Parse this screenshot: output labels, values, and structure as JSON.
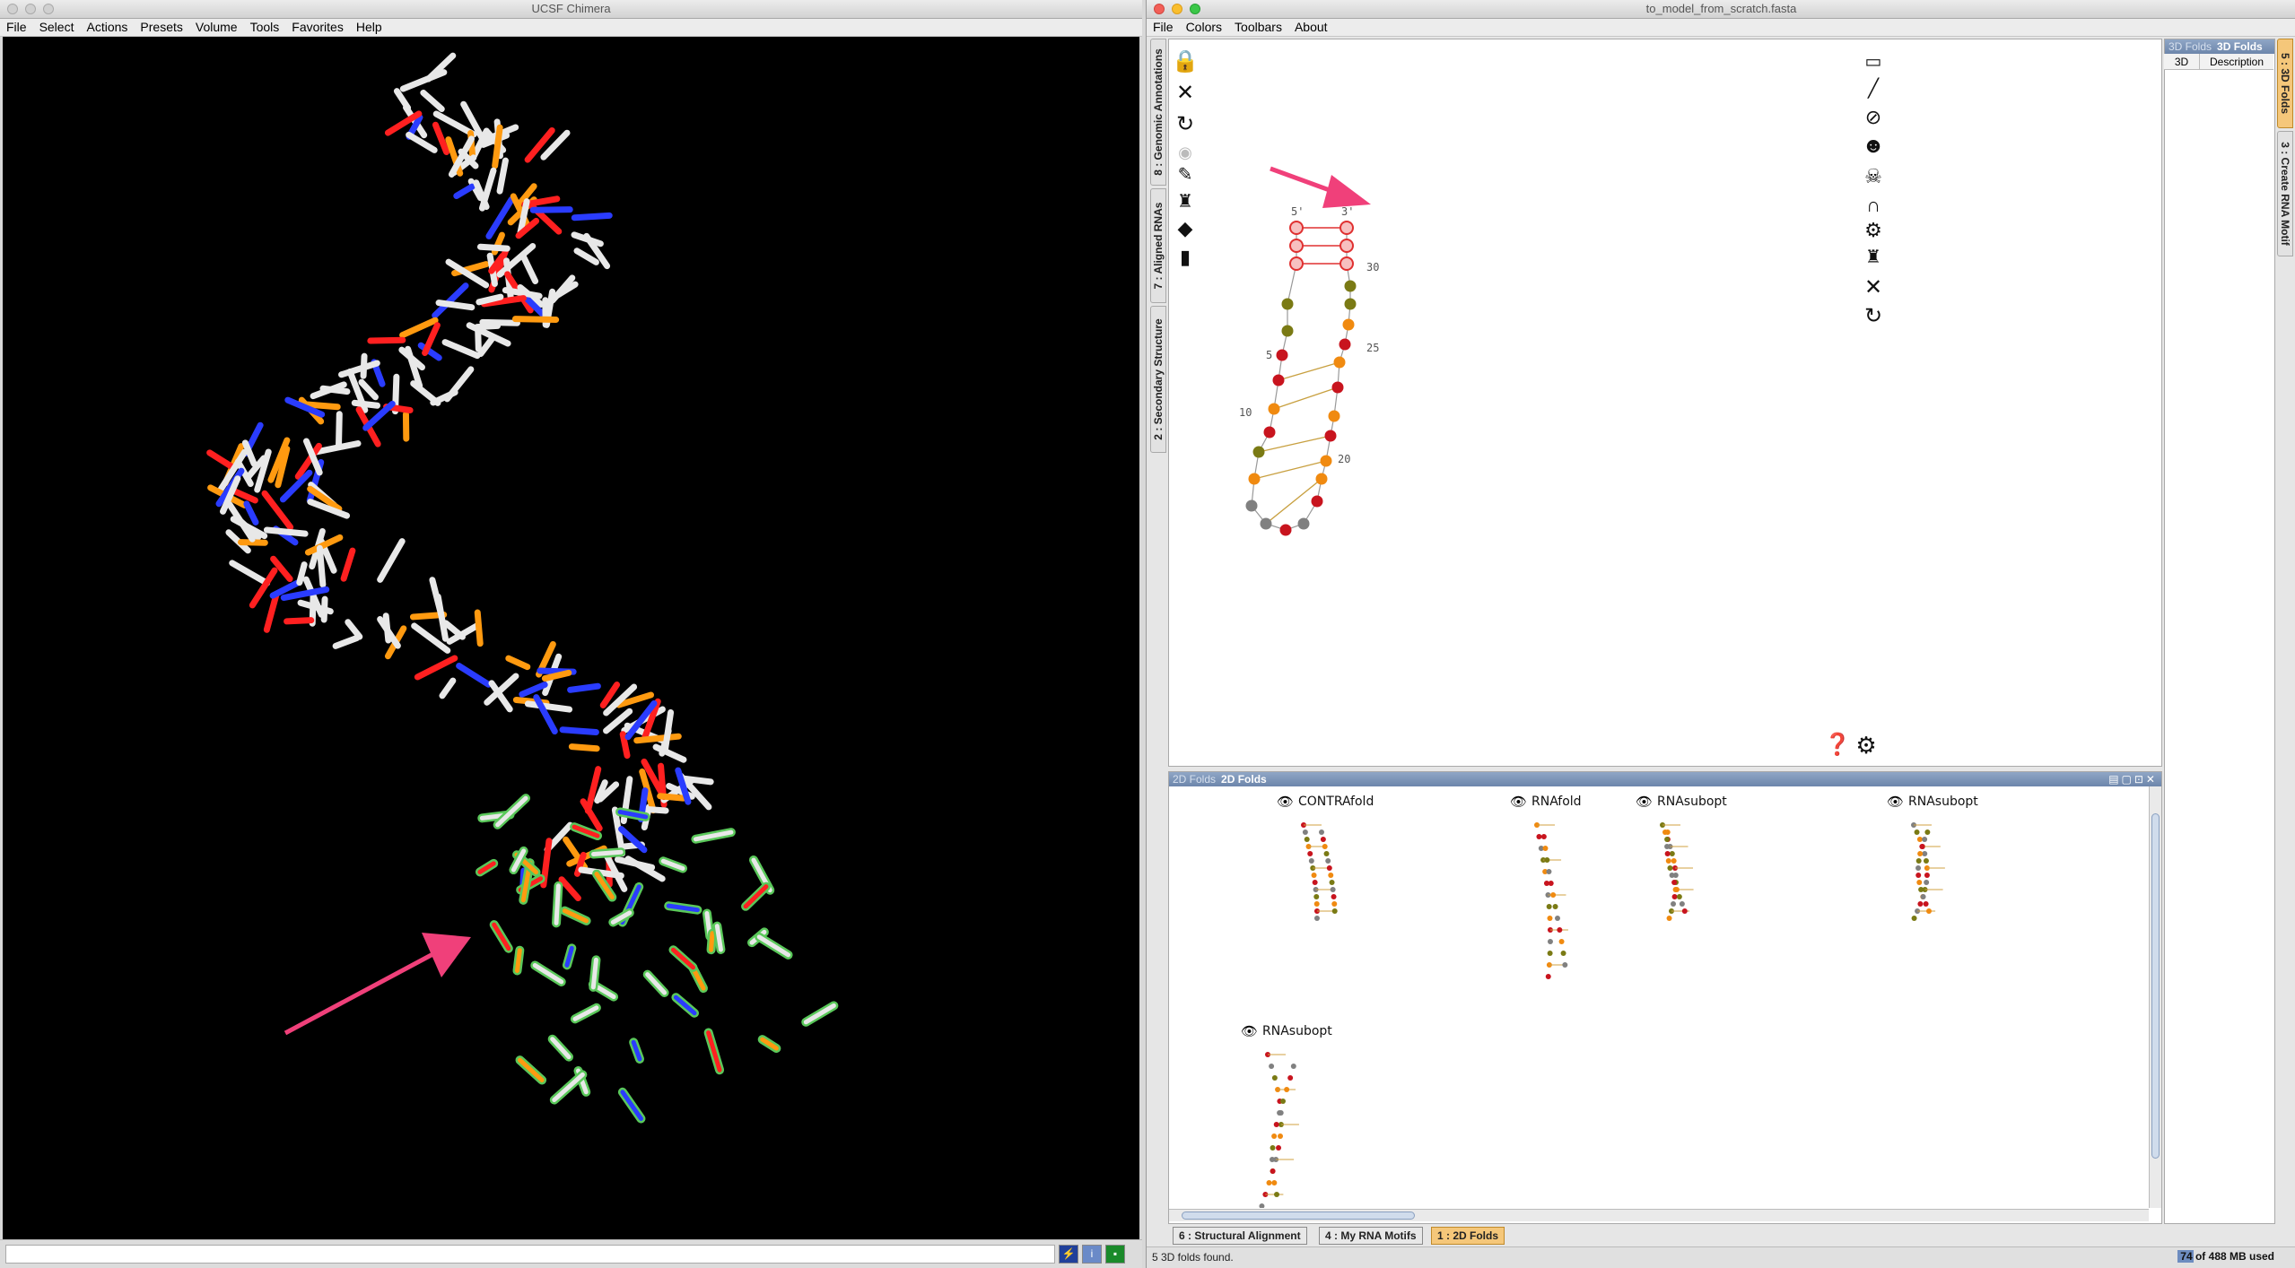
{
  "chimera": {
    "title": "UCSF Chimera",
    "menu": [
      "File",
      "Select",
      "Actions",
      "Presets",
      "Volume",
      "Tools",
      "Favorites",
      "Help"
    ]
  },
  "app": {
    "title": "to_model_from_scratch.fasta",
    "menu": [
      "File",
      "Colors",
      "Toolbars",
      "About"
    ],
    "left_tabs": [
      "8 : Genomic Annotations",
      "7 : Aligned RNAs",
      "2 : Secondary Structure"
    ],
    "right_tabs": [
      "5 : 3D Folds",
      "3 : Create RNA Motif"
    ],
    "folds3d_panel": {
      "header_ghost": "3D Folds",
      "header": "3D Folds",
      "columns": [
        "3D",
        "Description"
      ]
    },
    "secondary": {
      "end5": "5'",
      "end3": "3'",
      "positions": [
        "5",
        "10",
        "20",
        "25",
        "30"
      ]
    },
    "folds2d_panel": {
      "header_ghost": "2D Folds",
      "header": "2D Folds",
      "folds": [
        {
          "name": "CONTRAfold"
        },
        {
          "name": "RNAfold"
        },
        {
          "name": "RNAsubopt"
        },
        {
          "name": "RNAsubopt"
        },
        {
          "name": "RNAsubopt"
        }
      ]
    },
    "bottom_tabs": [
      "6 : Structural Alignment",
      "4 : My RNA Motifs",
      "1 : 2D Folds"
    ],
    "status": "5 3D folds found.",
    "memory": "74 of 488 MB used"
  },
  "colors": {
    "accent_arrow": "#f0407a",
    "nt_red": "#c8141e",
    "nt_orange": "#f08a10",
    "nt_olive": "#7a7a14",
    "nt_gray": "#808080"
  }
}
